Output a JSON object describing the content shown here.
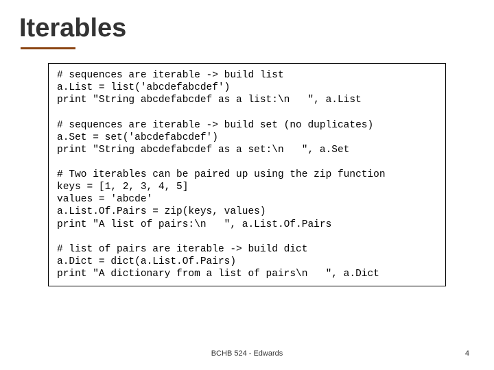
{
  "title": "Iterables",
  "code": "# sequences are iterable -> build list\na.List = list('abcdefabcdef')\nprint \"String abcdefabcdef as a list:\\n   \", a.List\n\n# sequences are iterable -> build set (no duplicates)\na.Set = set('abcdefabcdef')\nprint \"String abcdefabcdef as a set:\\n   \", a.Set\n\n# Two iterables can be paired up using the zip function\nkeys = [1, 2, 3, 4, 5]\nvalues = 'abcde'\na.List.Of.Pairs = zip(keys, values)\nprint \"A list of pairs:\\n   \", a.List.Of.Pairs\n\n# list of pairs are iterable -> build dict\na.Dict = dict(a.List.Of.Pairs)\nprint \"A dictionary from a list of pairs\\n   \", a.Dict",
  "footer_center": "BCHB 524 - Edwards",
  "footer_right": "4"
}
